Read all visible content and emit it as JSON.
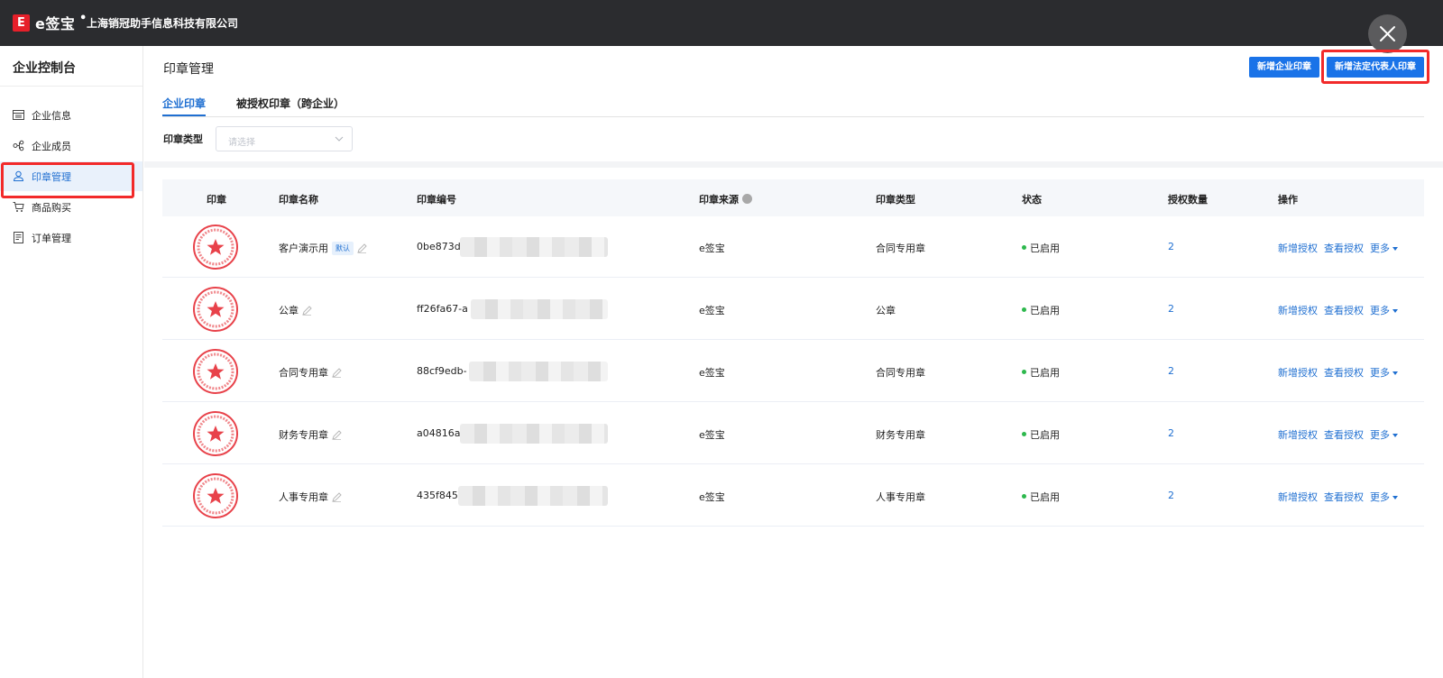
{
  "header": {
    "logo_letter": "E",
    "brand": "e签宝",
    "separator": "•",
    "company": "上海销冠助手信息科技有限公司"
  },
  "sidebar": {
    "title": "企业控制台",
    "items": [
      {
        "label": "企业信息",
        "icon": "list-icon"
      },
      {
        "label": "企业成员",
        "icon": "org-icon"
      },
      {
        "label": "印章管理",
        "icon": "seal-user-icon"
      },
      {
        "label": "商品购买",
        "icon": "cart-icon"
      },
      {
        "label": "订单管理",
        "icon": "order-icon"
      }
    ],
    "active_index": 2
  },
  "main": {
    "title": "印章管理",
    "buttons": {
      "add_company_seal": "新增企业印章",
      "add_legal_rep_seal": "新增法定代表人印章"
    },
    "tabs": [
      {
        "label": "企业印章"
      },
      {
        "label": "被授权印章（跨企业）"
      }
    ],
    "filter": {
      "label": "印章类型",
      "placeholder": "请选择"
    }
  },
  "table": {
    "columns": [
      "印章",
      "印章名称",
      "印章编号",
      "印章来源",
      "印章类型",
      "状态",
      "授权数量",
      "操作"
    ],
    "rows": [
      {
        "name": "客户演示用",
        "default_tag": "默认",
        "code": "0be873d",
        "source": "e签宝",
        "type": "合同专用章",
        "status": "已启用",
        "auth_count": "2"
      },
      {
        "name": "公章",
        "default_tag": "",
        "code": "ff26fa67-a",
        "source": "e签宝",
        "type": "公章",
        "status": "已启用",
        "auth_count": "2"
      },
      {
        "name": "合同专用章",
        "default_tag": "",
        "code": "88cf9edb-",
        "source": "e签宝",
        "type": "合同专用章",
        "status": "已启用",
        "auth_count": "2"
      },
      {
        "name": "财务专用章",
        "default_tag": "",
        "code": "a04816a",
        "source": "e签宝",
        "type": "财务专用章",
        "status": "已启用",
        "auth_count": "2"
      },
      {
        "name": "人事专用章",
        "default_tag": "",
        "code": "435f845",
        "source": "e签宝",
        "type": "人事专用章",
        "status": "已启用",
        "auth_count": "2"
      }
    ],
    "actions": {
      "add_auth": "新增授权",
      "view_auth": "查看授权",
      "more": "更多"
    }
  },
  "colors": {
    "accent": "#1a73e8",
    "header_bg": "#2b2c2f",
    "highlight_red": "#f22a2a",
    "seal_red": "#e8424a",
    "status_green": "#2db84d"
  }
}
